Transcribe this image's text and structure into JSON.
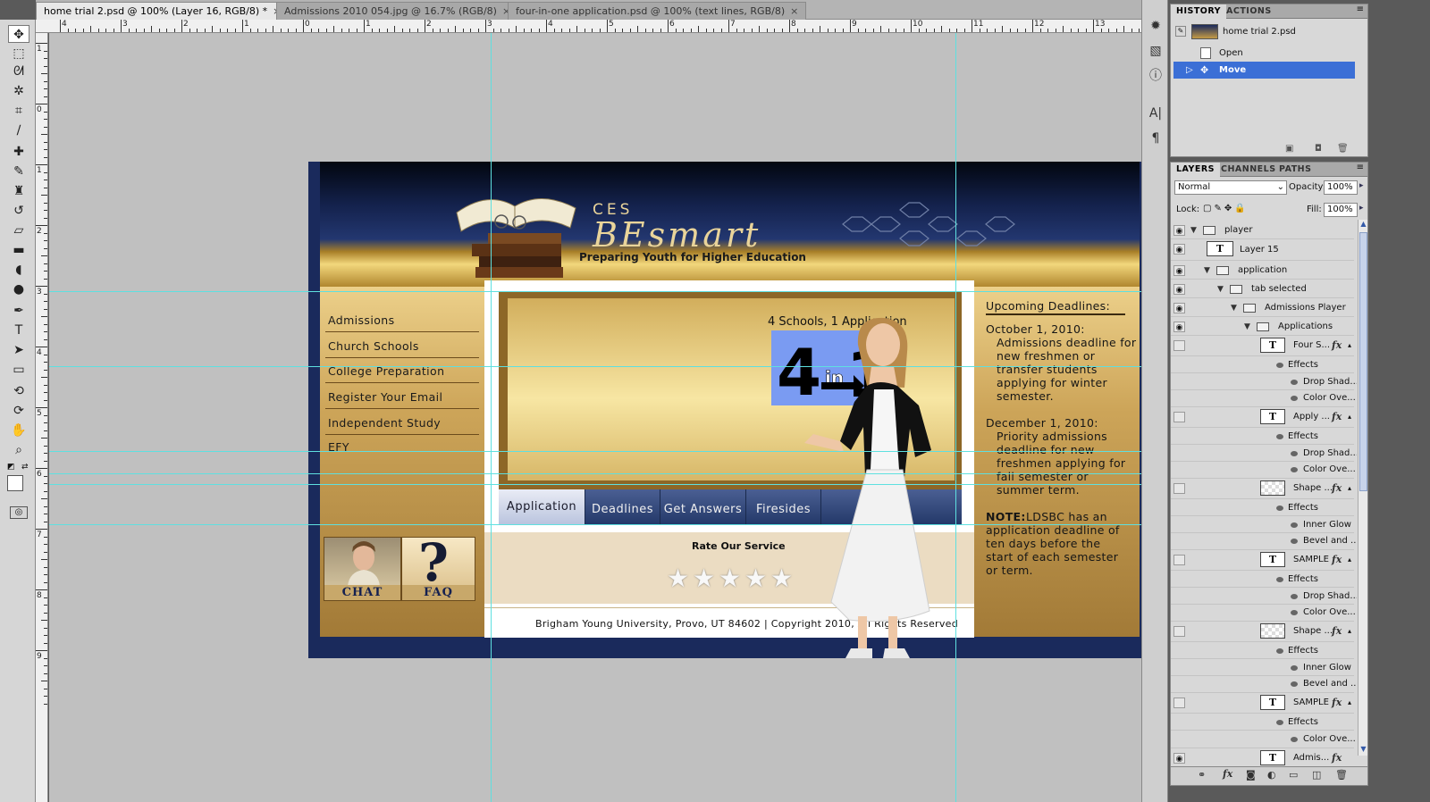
{
  "tabs": [
    {
      "label": "home trial 2.psd @ 100% (Layer 16, RGB/8) *",
      "active": true
    },
    {
      "label": "Admissions 2010 054.jpg @ 16.7% (RGB/8)",
      "active": false
    },
    {
      "label": "four-in-one application.psd @ 100% (text lines, RGB/8)",
      "active": false
    }
  ],
  "rulers": {
    "top": [
      "4",
      "3",
      "2",
      "1",
      "0",
      "1",
      "2",
      "3",
      "4",
      "5",
      "6",
      "7",
      "8",
      "9",
      "10",
      "11",
      "12",
      "13"
    ],
    "left": [
      "1",
      "0",
      "1",
      "2",
      "3",
      "4",
      "5",
      "6",
      "7",
      "8",
      "9"
    ]
  },
  "site": {
    "logo_ces": "CES",
    "logo_smart": "BEsmart",
    "tagline": "Preparing Youth for Higher Education",
    "nav": [
      "Admissions",
      "Church Schools",
      "College Preparation",
      "Register Your Email",
      "Independent Study",
      "EFY"
    ],
    "chat_label": "CHAT",
    "faq_label": "FAQ",
    "schools_label": "4 Schools, 1 Application",
    "player_tabs": [
      "Application",
      "Deadlines",
      "Get Answers",
      "Firesides"
    ],
    "rate_title": "Rate Our Service",
    "footer": "Brigham Young University, Provo, UT 84602 | Copyright 2010, All Rights Reserved",
    "deadlines_title": "Upcoming Deadlines:",
    "deadline1_date": "October 1, 2010:",
    "deadline1_text": [
      "Admissions deadline for",
      "new freshmen or",
      "transfer students",
      "applying for winter",
      "semester."
    ],
    "deadline2_date": "December 1, 2010:",
    "deadline2_text": [
      "Priority admissions",
      "deadline for new",
      "freshmen applying for",
      "fall semester or",
      "summer term."
    ],
    "note_label": "NOTE:",
    "note_text": [
      "LDSBC has an",
      "application deadline of",
      "ten days before the",
      "start of each semester",
      "or term."
    ]
  },
  "history": {
    "tabs": [
      "HISTORY",
      "ACTIONS"
    ],
    "snapshot": "home trial 2.psd",
    "items": [
      "Open",
      "Move"
    ]
  },
  "layers": {
    "tabs": [
      "LAYERS",
      "CHANNELS",
      "PATHS"
    ],
    "blend_mode": "Normal",
    "opacity_label": "Opacity:",
    "opacity": "100%",
    "lock_label": "Lock:",
    "fill_label": "Fill:",
    "fill": "100%",
    "rows": [
      "player",
      "Layer 15",
      "application",
      "tab selected",
      "Admissions Player",
      "Applications",
      "Four S...",
      "Effects",
      "Drop Shad...",
      "Color Ove...",
      "Apply ...",
      "Effects",
      "Drop Shad...",
      "Color Ove...",
      "Shape ...",
      "Effects",
      "Inner Glow",
      "Bevel and ...",
      "SAMPLE",
      "Effects",
      "Drop Shad...",
      "Color Ove...",
      "Shape ...",
      "Effects",
      "Inner Glow",
      "Bevel and ...",
      "SAMPLE",
      "Effects",
      "Color Ove...",
      "Admis..."
    ]
  }
}
